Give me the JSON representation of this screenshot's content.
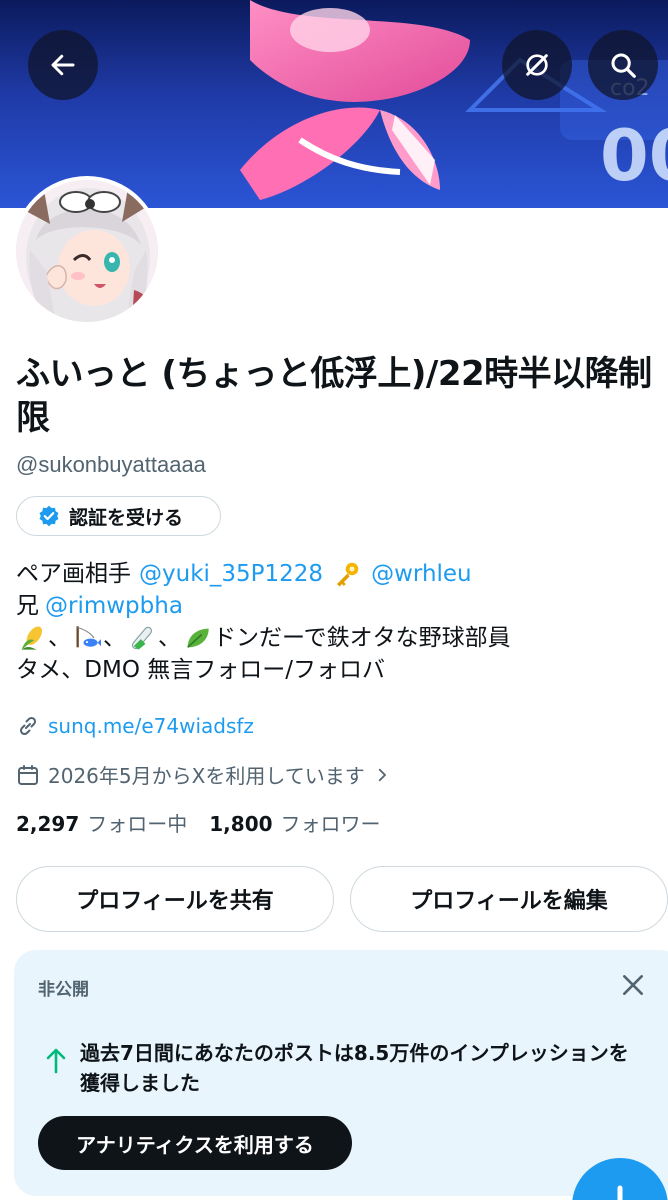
{
  "header": {
    "back_icon": "arrow-left-icon",
    "notify_icon": "bell-slash-icon",
    "search_icon": "search-icon"
  },
  "profile": {
    "display_name": "ふいっと (ちょっと低浮上)/22時半以降制限",
    "handle": "@sukonbuyattaaaa",
    "verify_label": "認証を受ける",
    "bio": {
      "line1_text": "ペア画相手 ",
      "line1_mention1": "@yuki_35P1228",
      "line1_mention2": "@wrhleu",
      "line2_text": "兄 ",
      "line2_mention": "@rimwpbha",
      "line3_sep1": "、",
      "line3_sep2": "、",
      "line3_sep3": "、",
      "line3_text": " ドンだーで鉄オタな野球部員",
      "line4_text": "タメ、DMO 無言フォロー/フォロバ"
    },
    "website": "sunq.me/e74wiadsfz",
    "joined": "2026年5月からXを利用しています",
    "following_count": "2,297",
    "following_label": "フォロー中",
    "followers_count": "1,800",
    "followers_label": "フォロワー"
  },
  "actions": {
    "share_label": "プロフィールを共有",
    "edit_label": "プロフィールを編集"
  },
  "private_card": {
    "label": "非公開",
    "message": "過去7日間にあなたのポストは8.5万件のインプレッションを獲得しました",
    "button_label": "アナリティクスを利用する"
  },
  "colors": {
    "accent": "#1d9bf0",
    "text": "#0f1419",
    "secondary": "#536471",
    "card_bg": "#e8f5fd",
    "up_arrow": "#00ba7c"
  }
}
